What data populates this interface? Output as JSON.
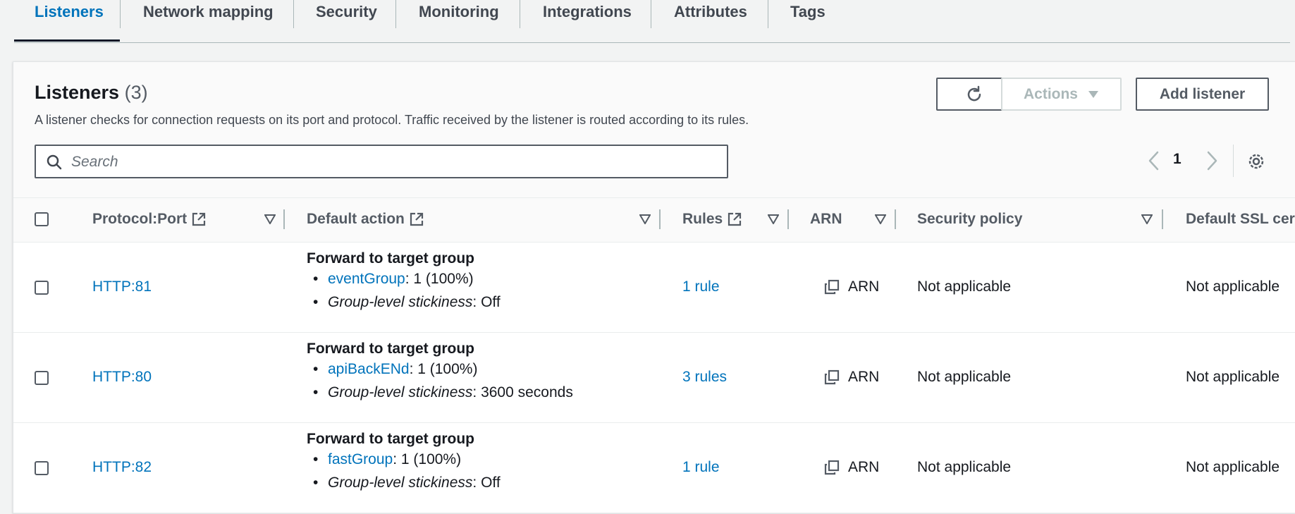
{
  "tabs": [
    {
      "label": "Listeners",
      "active": true
    },
    {
      "label": "Network mapping"
    },
    {
      "label": "Security"
    },
    {
      "label": "Monitoring"
    },
    {
      "label": "Integrations"
    },
    {
      "label": "Attributes"
    },
    {
      "label": "Tags"
    }
  ],
  "panel": {
    "title": "Listeners",
    "count": "(3)",
    "description": "A listener checks for connection requests on its port and protocol. Traffic received by the listener is routed according to its rules.",
    "search_placeholder": "Search",
    "actions_label": "Actions",
    "add_label": "Add listener",
    "page": "1"
  },
  "columns": {
    "protocol": "Protocol:Port",
    "default_action": "Default action",
    "rules": "Rules",
    "arn": "ARN",
    "security_policy": "Security policy",
    "default_ssl": "Default SSL cer"
  },
  "rows": [
    {
      "protocol": "HTTP:81",
      "action_title": "Forward to target group",
      "target_group": "eventGroup",
      "target_weight": ": 1 (100%)",
      "stickiness_label": "Group-level stickiness",
      "stickiness_value": ": Off",
      "rules": "1 rule",
      "arn": "ARN",
      "security_policy": "Not applicable",
      "default_ssl": "Not applicable"
    },
    {
      "protocol": "HTTP:80",
      "action_title": "Forward to target group",
      "target_group": "apiBackENd",
      "target_weight": ": 1 (100%)",
      "stickiness_label": "Group-level stickiness",
      "stickiness_value": ": 3600 seconds",
      "rules": "3 rules",
      "arn": "ARN",
      "security_policy": "Not applicable",
      "default_ssl": "Not applicable"
    },
    {
      "protocol": "HTTP:82",
      "action_title": "Forward to target group",
      "target_group": "fastGroup",
      "target_weight": ": 1 (100%)",
      "stickiness_label": "Group-level stickiness",
      "stickiness_value": ": Off",
      "rules": "1 rule",
      "arn": "ARN",
      "security_policy": "Not applicable",
      "default_ssl": "Not applicable"
    }
  ],
  "colors": {
    "link": "#0073bb",
    "text": "#16191f",
    "muted": "#545b64",
    "background": "#f2f3f3"
  }
}
